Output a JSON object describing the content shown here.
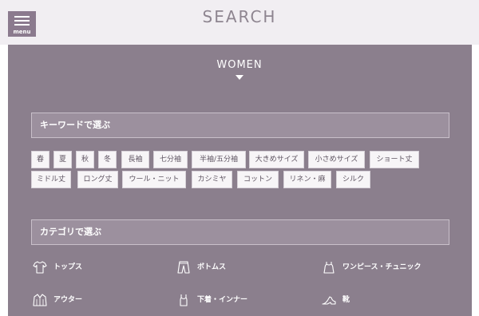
{
  "header": {
    "title": "SEARCH",
    "menu_label": "menu"
  },
  "gender": "WOMEN",
  "keyword_section": {
    "title": "キーワードで選ぶ",
    "tags": [
      "春",
      "夏",
      "秋",
      "冬",
      "長袖",
      "七分袖",
      "半袖/五分袖",
      "大きめサイズ",
      "小さめサイズ",
      "ショート丈",
      "ミドル丈",
      "ロング丈",
      "ウール・ニット",
      "カシミヤ",
      "コットン",
      "リネン・麻",
      "シルク"
    ]
  },
  "category_section": {
    "title": "カテゴリで選ぶ",
    "items": [
      {
        "label": "トップス",
        "icon": "tshirt-icon"
      },
      {
        "label": "ボトムス",
        "icon": "pants-icon"
      },
      {
        "label": "ワンピース・チュニック",
        "icon": "dress-icon"
      },
      {
        "label": "アウター",
        "icon": "coat-icon"
      },
      {
        "label": "下着・インナー",
        "icon": "camisole-icon"
      },
      {
        "label": "靴",
        "icon": "shoe-icon"
      }
    ]
  },
  "colors": {
    "panel": "#8b7f8d",
    "topbar": "#f1eef2",
    "menu_button": "#8b7a8e",
    "section_header": "#9c909e"
  }
}
